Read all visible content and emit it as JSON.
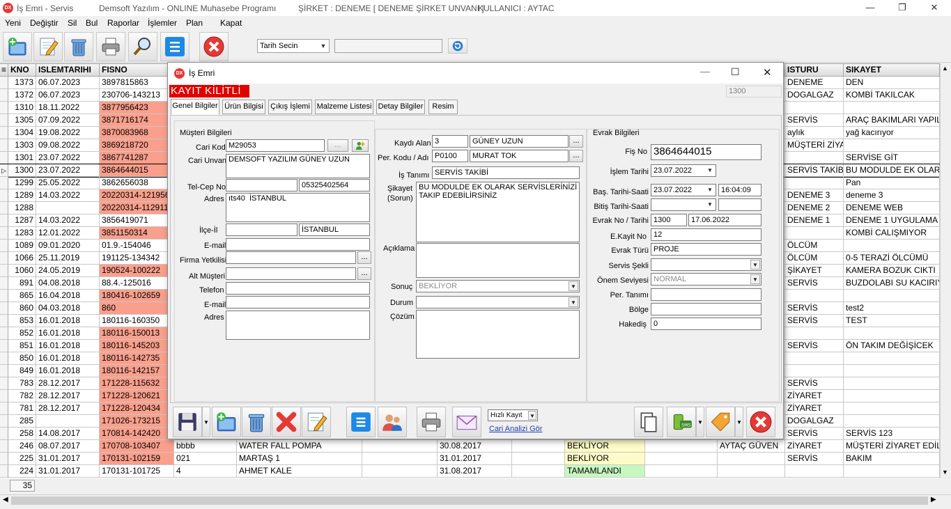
{
  "window": {
    "title": "İş Emri - Servis",
    "app": "Demsoft Yazılım - ONLINE Muhasebe Programı",
    "company": "ŞİRKET : DENEME [ DENEME ŞİRKET UNVANI ]",
    "user": "KULLANICI : AYTAC",
    "logo": "DX"
  },
  "menu": [
    "Yeni",
    "Değiştir",
    "Sil",
    "Bul",
    "Raporlar",
    "İşlemler",
    "Plan",
    "Kapat"
  ],
  "toolbar": {
    "date_select": "Tarih Secin",
    "date_text": ""
  },
  "grid": {
    "columns": [
      "KNO",
      "ISLEMTARIHI",
      "FISNO"
    ],
    "columns_right": [
      "ISTURU",
      "SIKAYET"
    ],
    "rows": [
      [
        "1373",
        "06.07.2023",
        "3897815863",
        "",
        "DENEME",
        "DEN",
        ""
      ],
      [
        "1372",
        "06.07.2023",
        "230706-143213",
        "",
        "DOGALGAZ",
        "KOMBİ TAKILCAK",
        ""
      ],
      [
        "1310",
        "18.11.2022",
        "3877956423",
        "s",
        "",
        "",
        ""
      ],
      [
        "1305",
        "07.09.2022",
        "3871716174",
        "s",
        "SERVİS",
        "ARAÇ BAKIMLARI YAPILCAK",
        ""
      ],
      [
        "1304",
        "19.08.2022",
        "3870083968",
        "s",
        "aylık",
        "yağ kacırıyor",
        ""
      ],
      [
        "1303",
        "09.08.2022",
        "3869218720",
        "s",
        "MÜŞTERİ ZİYARETİ",
        "",
        ""
      ],
      [
        "1301",
        "23.07.2022",
        "3867741287",
        "s",
        "",
        "SERVİSE GİT",
        ""
      ],
      [
        "1300",
        "23.07.2022",
        "3864644015",
        "s",
        "SERVİS TAKİBİ",
        "BU MODULDE EK OLARAK SERVİSLERİNİZİ",
        "sel"
      ],
      [
        "1299",
        "25.05.2022",
        "3862656038",
        "",
        "",
        "Pan",
        ""
      ],
      [
        "1289",
        "14.03.2022",
        "20220314-121956",
        "s",
        "DENEME 3",
        "deneme 3",
        ""
      ],
      [
        "1288",
        "",
        "20220314-112911",
        "s",
        "DENEME 2",
        "DENEME WEB",
        ""
      ],
      [
        "1287",
        "14.03.2022",
        "3856419071",
        "",
        "DENEME 1",
        "DENEME 1 UYGULAMA",
        ""
      ],
      [
        "1283",
        "12.01.2022",
        "3851150314",
        "s",
        "",
        "KOMBİ CALIŞMIYOR",
        ""
      ],
      [
        "1089",
        "09.01.2020",
        "01.9.-154046",
        "",
        "ÖLCÜM",
        "",
        ""
      ],
      [
        "1066",
        "25.11.2019",
        "191125-134342",
        "",
        "ÖLCÜM",
        "0-5 TERAZİ ÖLCÜMÜ",
        ""
      ],
      [
        "1060",
        "24.05.2019",
        "190524-100222",
        "s",
        "ŞİKAYET",
        "KAMERA BOZUK CIKTI",
        ""
      ],
      [
        "891",
        "04.08.2018",
        "88.4.-125016",
        "",
        "SERVİS",
        "BUZDOLABI SU KACIRIYOR",
        ""
      ],
      [
        "865",
        "16.04.2018",
        "180416-102659",
        "s",
        "",
        "",
        ""
      ],
      [
        "860",
        "04.03.2018",
        "860",
        "s",
        "SERVİS",
        "test2",
        ""
      ],
      [
        "853",
        "16.01.2018",
        "180116-160350",
        "",
        "SERVİS",
        "TEST",
        ""
      ],
      [
        "852",
        "16.01.2018",
        "180116-150013",
        "s",
        "",
        "",
        ""
      ],
      [
        "851",
        "16.01.2018",
        "180116-145203",
        "s",
        "SERVİS",
        "ÖN TAKIM DEĞİŞİCEK",
        ""
      ],
      [
        "850",
        "16.01.2018",
        "180116-142735",
        "s",
        "",
        "",
        ""
      ],
      [
        "849",
        "16.01.2018",
        "180116-142157",
        "s",
        "",
        "",
        ""
      ],
      [
        "783",
        "28.12.2017",
        "171228-115632",
        "s",
        "SERVİS",
        "",
        ""
      ],
      [
        "782",
        "28.12.2017",
        "171228-120621",
        "s",
        "ZİYARET",
        "",
        ""
      ],
      [
        "781",
        "28.12.2017",
        "171228-120434",
        "s",
        "ZİYARET",
        "",
        ""
      ],
      [
        "285",
        "",
        "171026-173215",
        "s",
        "DOGALGAZ",
        "",
        ""
      ],
      [
        "258",
        "14.08.2017",
        "170814-142420",
        "s",
        "SERVİS",
        "SERVİS 123",
        ""
      ]
    ],
    "full_rows": [
      {
        "kno": "246",
        "date": "08.07.2017",
        "fis": "170708-103407",
        "c4": "bbbb",
        "c5": "WATER FALL POMPA",
        "c6": "",
        "c7": "30.08.2017",
        "c8": "",
        "status": "BEKLİYOR",
        "c10": "",
        "c11": "AYTAÇ GÜVEN",
        "tur": "ZİYARET",
        "sik": "MÜŞTERİ ZİYARET EDİLDİ",
        "salmon": true,
        "st": "yellow"
      },
      {
        "kno": "225",
        "date": "31.01.2017",
        "fis": "170131-102159",
        "c4": "021",
        "c5": "MARTAŞ 1",
        "c6": "",
        "c7": "31.01.2017",
        "c8": "",
        "status": "BEKLİYOR",
        "c10": "",
        "c11": "",
        "tur": "SERVİS",
        "sik": "BAKIM",
        "salmon": true,
        "st": "yellow"
      },
      {
        "kno": "224",
        "date": "31.01.2017",
        "fis": "170131-101725",
        "c4": "4",
        "c5": "AHMET KALE",
        "c6": "",
        "c7": "31.08.2017",
        "c8": "",
        "status": "TAMAMLANDI",
        "c10": "",
        "c11": "",
        "tur": "",
        "sik": "",
        "salmon": false,
        "st": "green"
      }
    ],
    "count": "35"
  },
  "dialog": {
    "title": "İş Emri",
    "locked": "KAYIT KİLİTLİ",
    "record_no": "1300",
    "tabs": [
      "Genel Bilgiler",
      "Ürün Bilgisi",
      "Çıkış İşlemi",
      "Malzeme Listesi",
      "Detay Bilgiler",
      "Resim"
    ],
    "customer": {
      "section": "Müşteri Bilgileri",
      "l_code": "Cari Kod",
      "code": "M29053",
      "l_name": "Cari Unvan",
      "name": "DEMSOFT YAZILIM GÜNEY UZUN",
      "l_tel": "Tel-Cep No",
      "tel": "",
      "mobile": "05325402564",
      "l_addr": "Adres",
      "addr": "ıts40  İSTANBUL",
      "l_district": "İlçe-İl",
      "district": "",
      "city": "İSTANBUL",
      "l_email": "E-mail",
      "email": "",
      "l_officer": "Firma Yetkilisi",
      "officer": "",
      "l_sub": "Alt Müşteri",
      "sub": "",
      "l_phone2": "Telefon",
      "phone2": "",
      "l_email2": "E-mail",
      "email2": "",
      "l_addr2": "Adres",
      "addr2": ""
    },
    "middle": {
      "l_recorder": "Kaydı Alan",
      "recorder_code": "3",
      "recorder_name": "GÜNEY UZUN",
      "l_staff": "Per. Kodu / Adı",
      "staff_code": "P0100",
      "staff_name": "MURAT TOK",
      "l_job": "İş Tanımı",
      "job": "SERVİS TAKİBİ",
      "l_complaint": "Şikayet",
      "l_complaint2": "(Sorun)",
      "complaint": "BU MODULDE EK OLARAK SERVİSLERİNİZİ\nTAKIP EDEBİLİRSİNİZ",
      "l_desc": "Açıklama",
      "desc": "",
      "l_result": "Sonuç",
      "result": "BEKLİYOR",
      "l_status": "Durum",
      "status": "",
      "l_solution": "Çözüm",
      "solution": ""
    },
    "doc": {
      "section": "Evrak Bilgileri",
      "l_fis": "Fiş No",
      "fis": "3864644015",
      "l_date": "İşlem Tarihi",
      "date": "23.07.2022",
      "l_start": "Baş. Tarihi-Saati",
      "start_date": "23.07.2022",
      "start_time": "16:04:09",
      "l_end": "Bitiş Tarihi-Saati",
      "end_date": "",
      "end_time": "",
      "l_evrak": "Evrak No  / Tarihi",
      "evrak_no": "1300",
      "evrak_date": "17.06.2022",
      "l_ekayit": "E.Kayit No",
      "ekayit": "12",
      "l_type": "Evrak Türü",
      "type": "PROJE",
      "l_service": "Servis Şekli",
      "service": "",
      "l_priority": "Önem Seviyesi",
      "priority": "NORMAL",
      "l_pertanim": "Per. Tanımı",
      "pertanim": "",
      "l_region": "Bölge",
      "region": "",
      "l_hakedis": "Hakediş",
      "hakedis": "0"
    },
    "footer": {
      "quick": "Hızlı Kayıt",
      "analysis": "Cari Analizi Gör"
    }
  }
}
